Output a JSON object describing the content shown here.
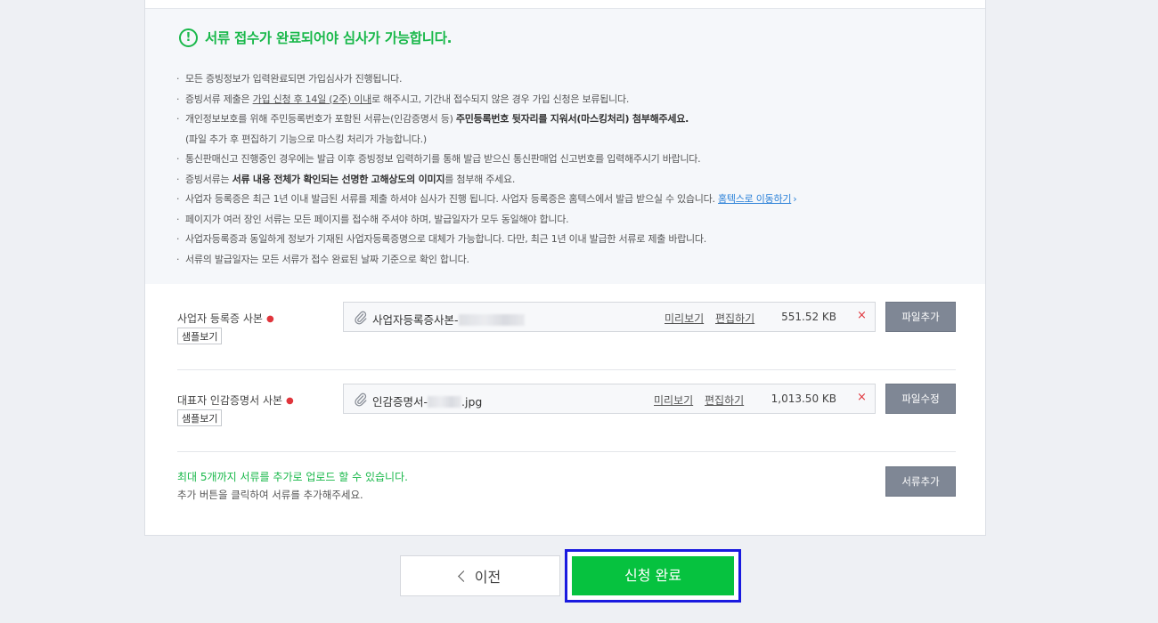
{
  "notice": {
    "title": "서류 접수가 완료되어야 심사가 가능합니다.",
    "items": [
      {
        "text": "모든 증빙정보가 입력완료되면 가입심사가 진행됩니다."
      },
      {
        "pre": "증빙서류 제출은 ",
        "underline": "가입 신청 후 14일 (2주) 이내",
        "post": "로 해주시고, 기간내 접수되지 않은 경우 가입 신청은 보류됩니다."
      },
      {
        "pre": "개인정보보호를 위해 주민등록번호가 포함된 서류는(인감증명서 등) ",
        "bold": "주민등록번호 뒷자리를 지워서(마스킹처리) 첨부해주세요."
      },
      {
        "sub": "(파일 추가 후 편집하기 기능으로 마스킹 처리가 가능합니다.)"
      },
      {
        "text": "통신판매신고 진행중인 경우에는 발급 이후 증빙정보 입력하기를 통해 발급 받으신 통신판매업 신고번호를 입력해주시기 바랍니다."
      },
      {
        "pre": "증빙서류는 ",
        "bold": "서류 내용 전체가 확인되는 선명한 고해상도의 이미지",
        "post": "를 첨부해 주세요."
      },
      {
        "pre": "사업자 등록증은 최근 1년 이내 발급된 서류를 제출 하셔야 심사가 진행 됩니다. 사업자 등록증은 홈텍스에서 발급 받으실 수 있습니다. ",
        "link": "홈텍스로 이동하기"
      },
      {
        "text": "페이지가 여러 장인 서류는 모든 페이지를 접수해 주셔야 하며, 발급일자가 모두 동일해야 합니다."
      },
      {
        "text": "사업자등록증과 동일하게 정보가 기재된 사업자등록증명으로 대체가 가능합니다. 다만, 최근 1년 이내 발급한 서류로 제출 바랍니다."
      },
      {
        "text": "서류의 발급일자는 모든 서류가 접수 완료된 날짜 기준으로 확인 합니다."
      }
    ]
  },
  "documents": [
    {
      "label": "사업자 등록증 사본",
      "sample_label": "샘플보기",
      "file_name": "사업자등록증사본-",
      "file_ext": "",
      "preview_label": "미리보기",
      "edit_label": "편집하기",
      "size": "551.52 KB",
      "delete_symbol": "×",
      "action_label": "파일추가"
    },
    {
      "label": "대표자 인감증명서 사본",
      "sample_label": "샘플보기",
      "file_name": "인감증명서-",
      "file_ext": ".jpg",
      "preview_label": "미리보기",
      "edit_label": "편집하기",
      "size": "1,013.50 KB",
      "delete_symbol": "×",
      "action_label": "파일수정"
    }
  ],
  "extra": {
    "info_green": "최대 5개까지 서류를 추가로 업로드 할 수 있습니다.",
    "info_gray": "추가 버튼을 클릭하여 서류를 추가해주세요.",
    "add_label": "서류추가"
  },
  "footer": {
    "prev_label": "이전",
    "submit_label": "신청 완료"
  },
  "colors": {
    "accent_green": "#06c23f",
    "required_red": "#e0353c",
    "highlight_border": "#1a1adf"
  }
}
